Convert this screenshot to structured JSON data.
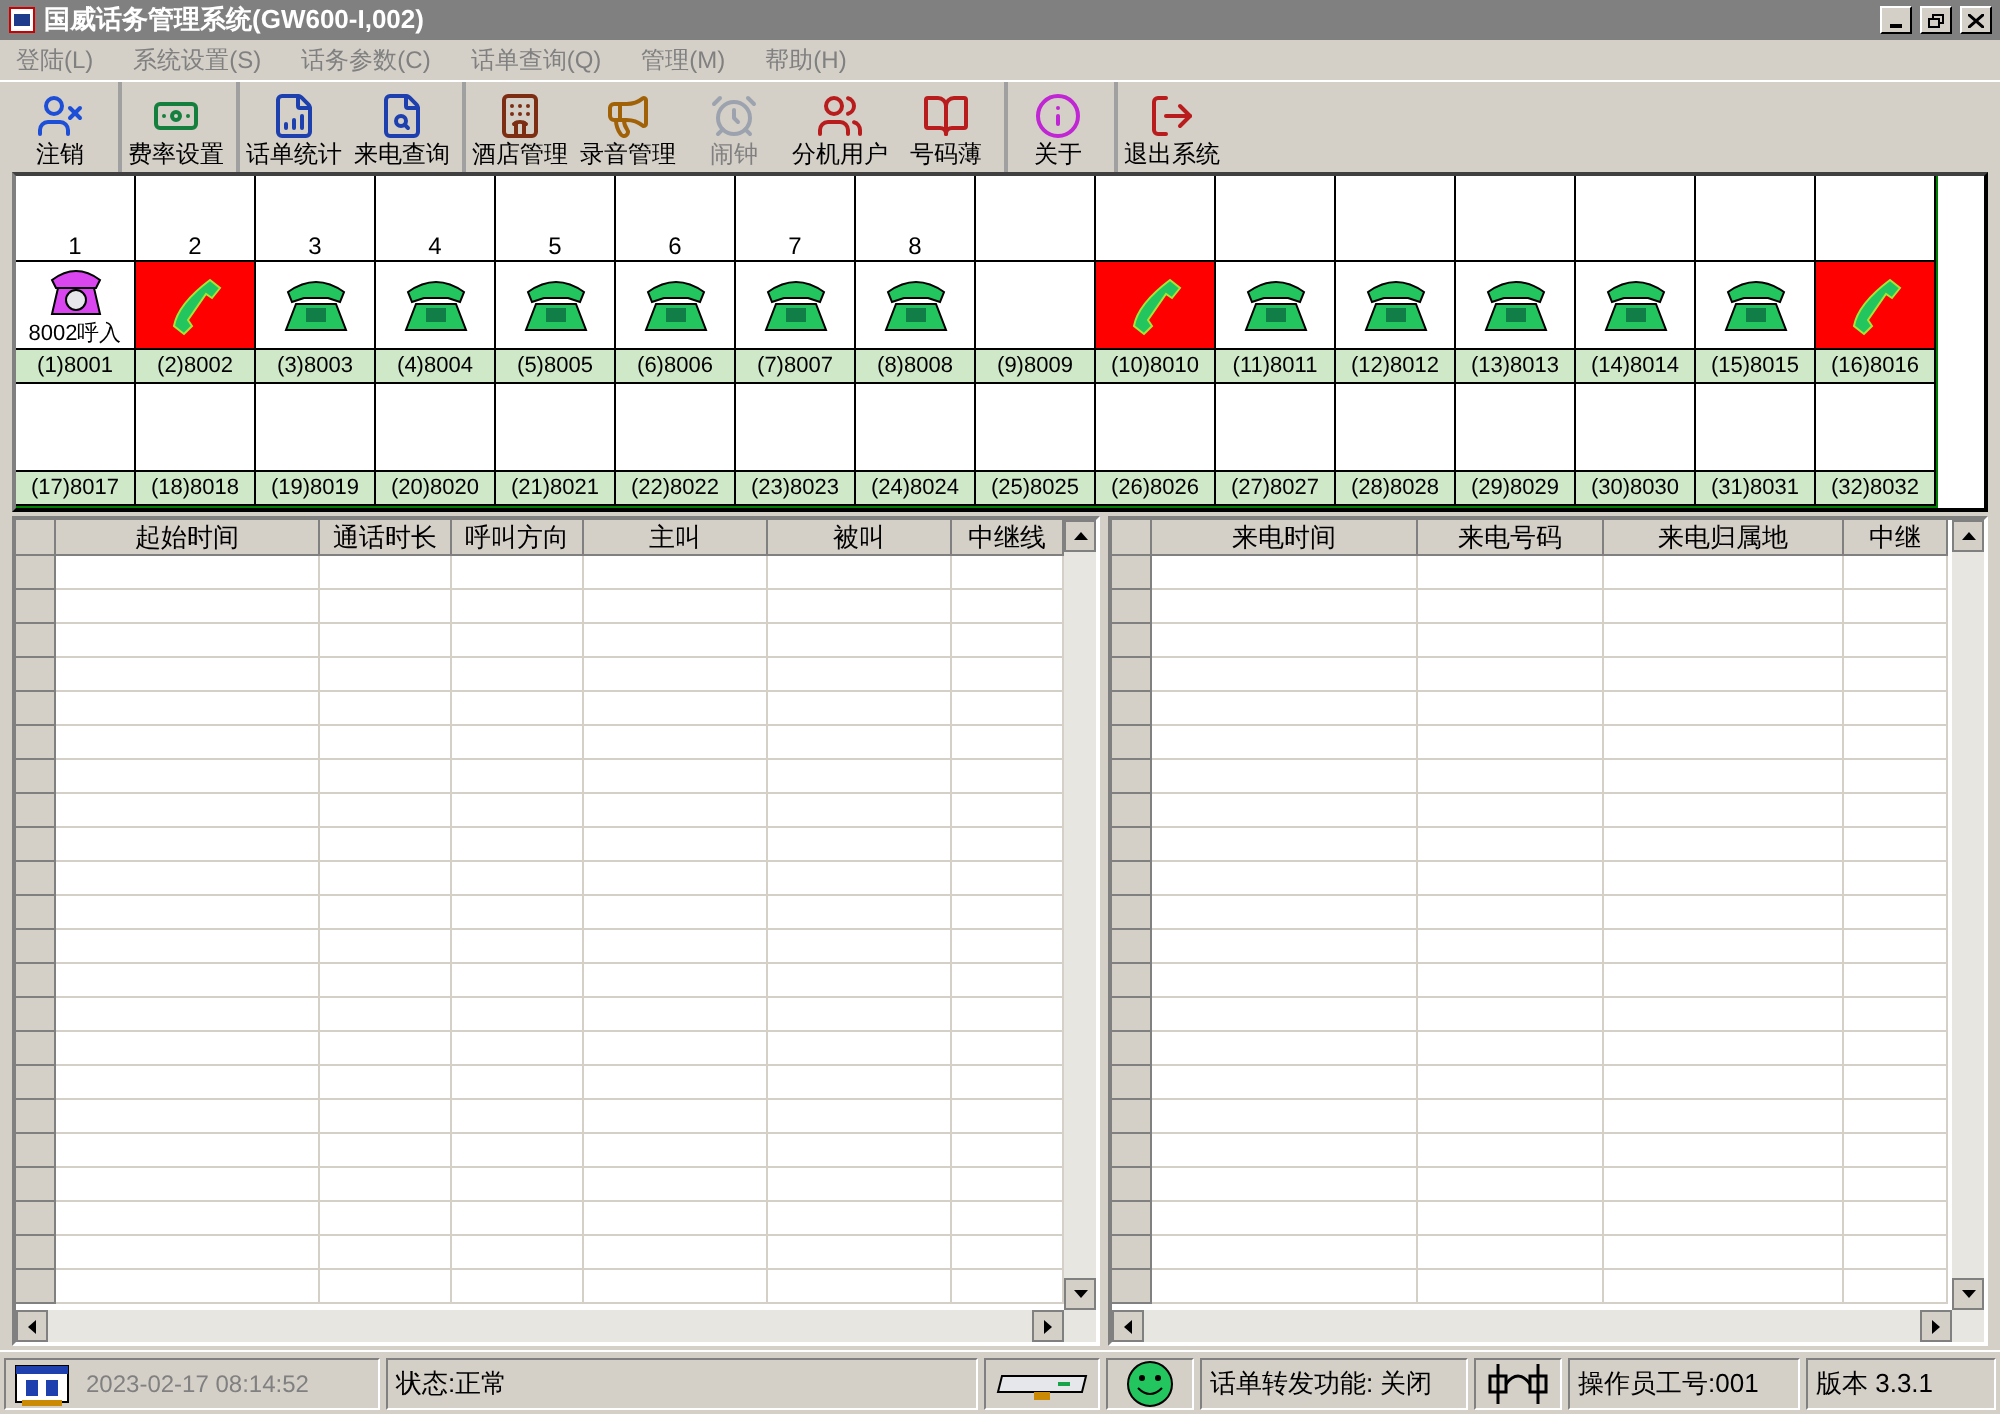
{
  "window": {
    "title": "国威话务管理系统(GW600-I,002)"
  },
  "menu": [
    {
      "label": "登陆(L)",
      "disabled": true
    },
    {
      "label": "系统设置(S)",
      "disabled": true
    },
    {
      "label": "话务参数(C)",
      "disabled": true
    },
    {
      "label": "话单查询(Q)",
      "disabled": true
    },
    {
      "label": "管理(M)",
      "disabled": true
    },
    {
      "label": "帮助(H)",
      "disabled": true
    }
  ],
  "toolbar": [
    {
      "label": "注销",
      "disabled": false,
      "separator_before": false
    },
    {
      "label": "费率设置",
      "disabled": false,
      "separator_before": true
    },
    {
      "label": "话单统计",
      "disabled": false,
      "separator_before": true
    },
    {
      "label": "来电查询",
      "disabled": false,
      "separator_before": false
    },
    {
      "label": "酒店管理",
      "disabled": false,
      "separator_before": true
    },
    {
      "label": "录音管理",
      "disabled": false,
      "separator_before": false
    },
    {
      "label": "闹钟",
      "disabled": true,
      "separator_before": false
    },
    {
      "label": "分机用户",
      "disabled": false,
      "separator_before": false
    },
    {
      "label": "号码薄",
      "disabled": false,
      "separator_before": false
    },
    {
      "label": "关于",
      "disabled": false,
      "separator_before": true
    },
    {
      "label": "退出系统",
      "disabled": false,
      "separator_before": true
    }
  ],
  "extension_rows": [
    {
      "numbers": [
        "1",
        "2",
        "3",
        "4",
        "5",
        "6",
        "7",
        "8"
      ],
      "extensions": [
        {
          "label": "(1)8001",
          "kind": "ringing",
          "caption": "8002呼入"
        },
        {
          "label": "(2)8002",
          "kind": "offhook"
        },
        {
          "label": "(3)8003",
          "kind": "idle"
        },
        {
          "label": "(4)8004",
          "kind": "idle"
        },
        {
          "label": "(5)8005",
          "kind": "idle"
        },
        {
          "label": "(6)8006",
          "kind": "idle"
        },
        {
          "label": "(7)8007",
          "kind": "idle"
        },
        {
          "label": "(8)8008",
          "kind": "idle"
        },
        {
          "label": "(9)8009",
          "kind": "none"
        },
        {
          "label": "(10)8010",
          "kind": "offhook"
        },
        {
          "label": "(11)8011",
          "kind": "idle"
        },
        {
          "label": "(12)8012",
          "kind": "idle"
        },
        {
          "label": "(13)8013",
          "kind": "idle"
        },
        {
          "label": "(14)8014",
          "kind": "idle"
        },
        {
          "label": "(15)8015",
          "kind": "idle"
        },
        {
          "label": "(16)8016",
          "kind": "offhook"
        }
      ]
    },
    {
      "extensions": [
        {
          "label": "(17)8017"
        },
        {
          "label": "(18)8018"
        },
        {
          "label": "(19)8019"
        },
        {
          "label": "(20)8020"
        },
        {
          "label": "(21)8021"
        },
        {
          "label": "(22)8022"
        },
        {
          "label": "(23)8023"
        },
        {
          "label": "(24)8024"
        },
        {
          "label": "(25)8025"
        },
        {
          "label": "(26)8026"
        },
        {
          "label": "(27)8027"
        },
        {
          "label": "(28)8028"
        },
        {
          "label": "(29)8029"
        },
        {
          "label": "(30)8030"
        },
        {
          "label": "(31)8031"
        },
        {
          "label": "(32)8032"
        }
      ]
    }
  ],
  "call_log_table": {
    "columns": [
      "起始时间",
      "通话时长",
      "呼叫方向",
      "主叫",
      "被叫",
      "中继线"
    ]
  },
  "incoming_table": {
    "columns": [
      "来电时间",
      "来电号码",
      "来电归属地",
      "中继"
    ]
  },
  "status_bar": {
    "datetime": "2023-02-17 08:14:52",
    "status": "状态:正常",
    "forwarding": "话单转发功能: 关闭",
    "operator": "操作员工号:001",
    "version": "版本 3.3.1"
  }
}
